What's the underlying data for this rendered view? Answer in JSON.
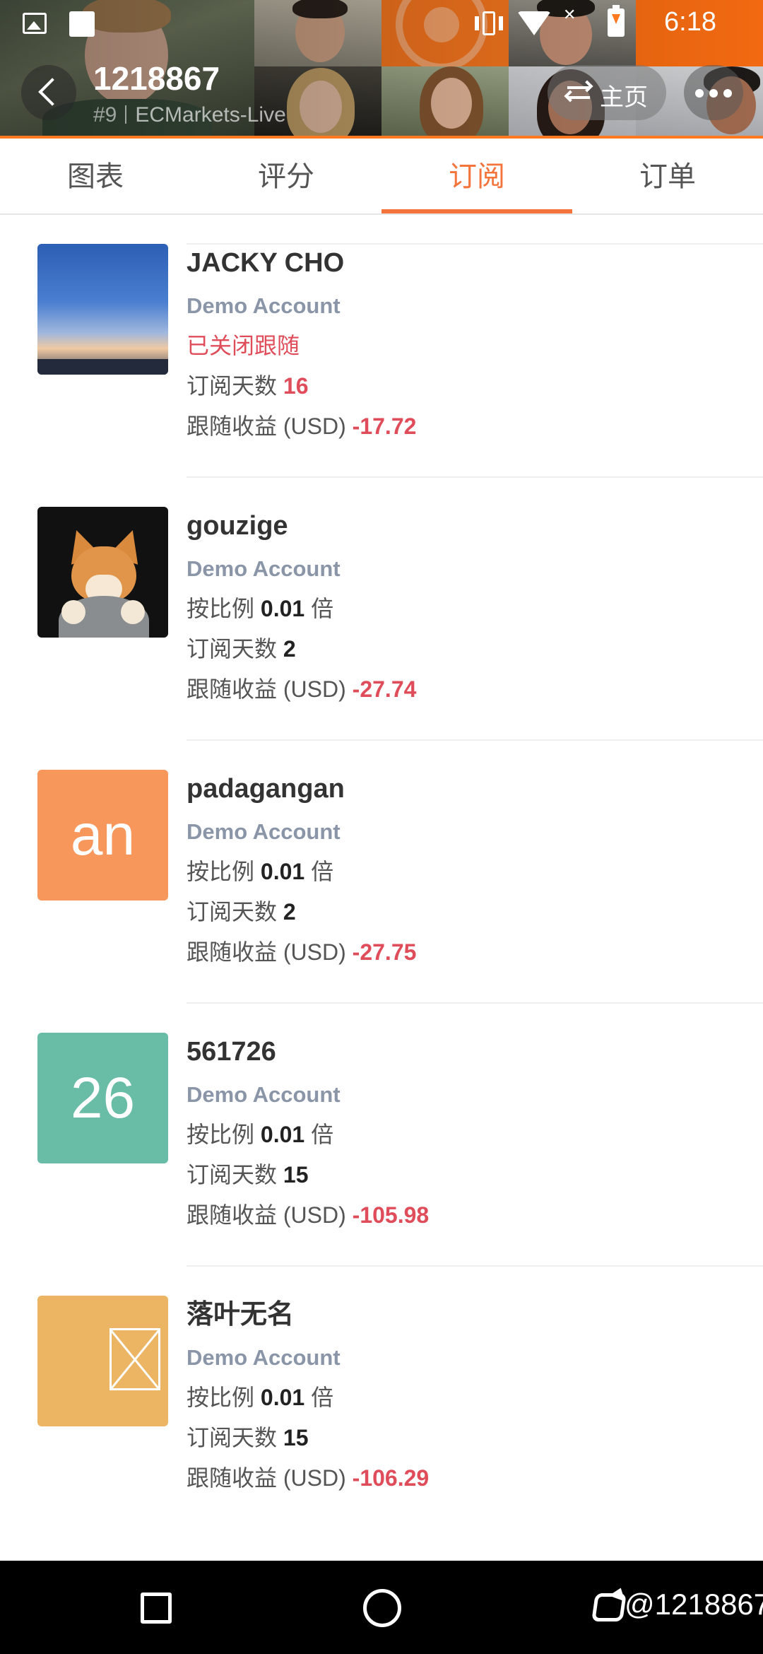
{
  "status_bar": {
    "time": "6:18",
    "x_mark": "✕"
  },
  "header": {
    "account_number": "1218867",
    "rank": "#9",
    "broker": "ECMarkets-Live",
    "home_button_label": "主页"
  },
  "tabs": [
    {
      "label": "图表",
      "active": false
    },
    {
      "label": "评分",
      "active": false
    },
    {
      "label": "订阅",
      "active": true
    },
    {
      "label": "订单",
      "active": false
    }
  ],
  "subscribers": [
    {
      "name": "JACKY CHO",
      "avatar": "photo-sunset-sky",
      "account_type": "Demo Account",
      "status": "已关闭跟随",
      "days_label": "订阅天数",
      "days": "16",
      "profit_label": "跟随收益 (USD)",
      "profit": "-17.72"
    },
    {
      "name": "gouzige",
      "avatar": "photo-corgi",
      "account_type": "Demo Account",
      "ratio_label": "按比例",
      "ratio": "0.01",
      "ratio_unit": "倍",
      "days_label": "订阅天数",
      "days": "2",
      "profit_label": "跟随收益 (USD)",
      "profit": "-27.74"
    },
    {
      "name": "padagangan",
      "avatar_text": "an",
      "account_type": "Demo Account",
      "ratio_label": "按比例",
      "ratio": "0.01",
      "ratio_unit": "倍",
      "days_label": "订阅天数",
      "days": "2",
      "profit_label": "跟随收益 (USD)",
      "profit": "-27.75"
    },
    {
      "name": "561726",
      "avatar_text": "26",
      "account_type": "Demo Account",
      "ratio_label": "按比例",
      "ratio": "0.01",
      "ratio_unit": "倍",
      "days_label": "订阅天数",
      "days": "15",
      "profit_label": "跟随收益 (USD)",
      "profit": "-105.98"
    },
    {
      "name": "落叶无名",
      "avatar": "image-placeholder-icon",
      "account_type": "Demo Account",
      "ratio_label": "按比例",
      "ratio": "0.01",
      "ratio_unit": "倍",
      "days_label": "订阅天数",
      "days": "15",
      "profit_label": "跟随收益 (USD)",
      "profit": "-106.29"
    }
  ],
  "watermark": "@1218867",
  "colors": {
    "accent": "#f4743b",
    "loss": "#e04d5a",
    "account_type": "#8a95a8",
    "avatar_orange": "#f7975c",
    "avatar_teal": "#69bda6",
    "avatar_yellow": "#ecb564"
  }
}
